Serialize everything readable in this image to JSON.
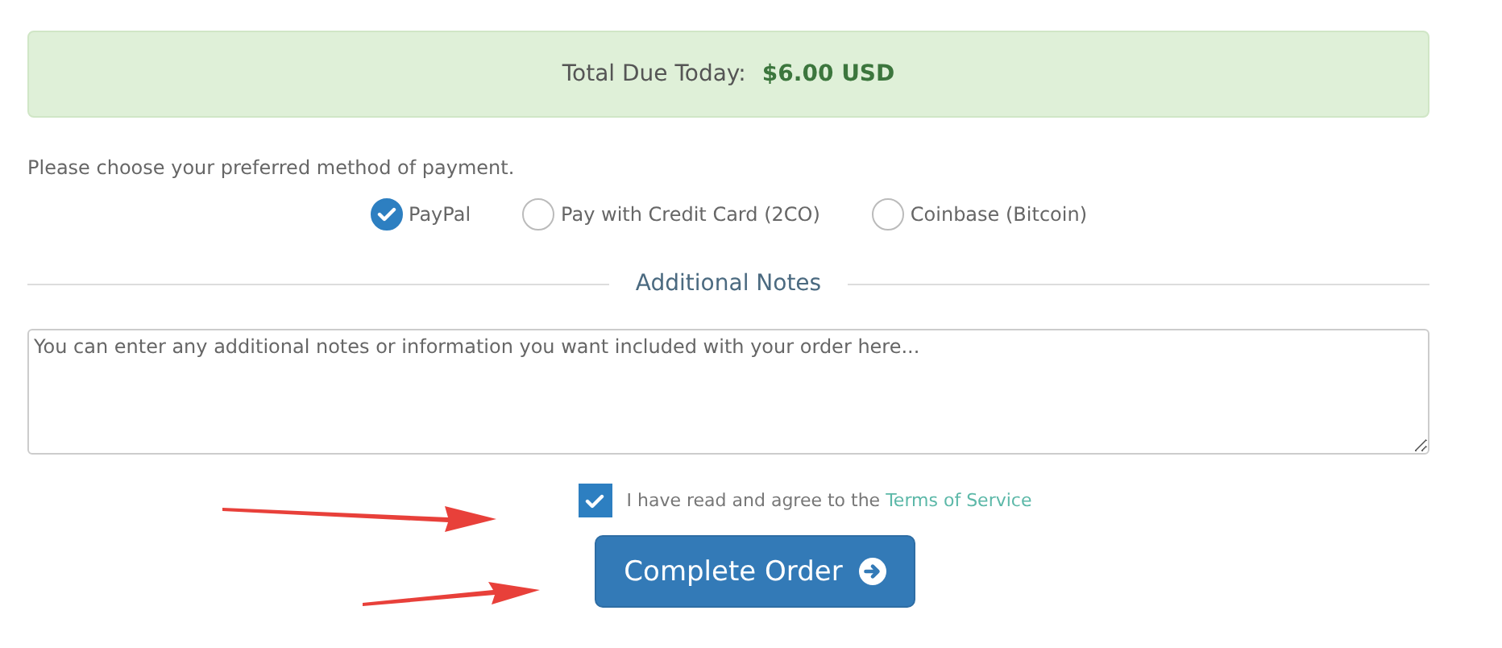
{
  "total": {
    "label": "Total Due Today:",
    "amount": "$6.00 USD"
  },
  "payment_prompt": "Please choose your preferred method of payment.",
  "payment_methods": [
    {
      "label": "PayPal",
      "selected": true
    },
    {
      "label": "Pay with Credit Card (2CO)",
      "selected": false
    },
    {
      "label": "Coinbase (Bitcoin)",
      "selected": false
    }
  ],
  "notes": {
    "heading": "Additional Notes",
    "placeholder": "You can enter any additional notes or information you want included with your order here..."
  },
  "terms": {
    "checked": true,
    "text": "I have read and agree to the",
    "link": "Terms of Service"
  },
  "submit": {
    "label": "Complete Order"
  }
}
